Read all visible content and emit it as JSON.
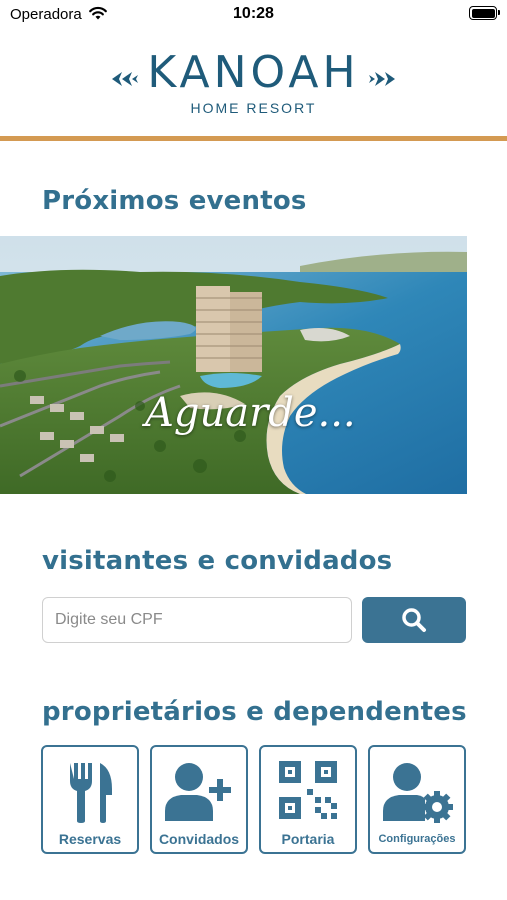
{
  "status_bar": {
    "carrier": "Operadora",
    "time": "10:28",
    "icons": [
      "wifi-icon",
      "battery-icon"
    ]
  },
  "header": {
    "logo_title": "KANOAH",
    "logo_subtitle": "HOME RESORT",
    "accent_line_color": "#d49a52"
  },
  "events": {
    "title": "Próximos eventos",
    "banner_text": "Aguarde..."
  },
  "visitors": {
    "title": "visitantes e convidados",
    "cpf_placeholder": "Digite seu CPF",
    "cpf_value": "",
    "search_icon": "search-icon"
  },
  "owners": {
    "title": "proprietários e dependentes",
    "tiles": [
      {
        "label": "Reservas",
        "icon": "fork-knife-icon"
      },
      {
        "label": "Convidados",
        "icon": "add-user-icon"
      },
      {
        "label": "Portaria",
        "icon": "qr-code-icon"
      },
      {
        "label": "Configurações",
        "icon": "user-settings-icon"
      }
    ]
  },
  "colors": {
    "primary": "#3b7393",
    "title": "#33708f",
    "accent": "#d49a52"
  }
}
